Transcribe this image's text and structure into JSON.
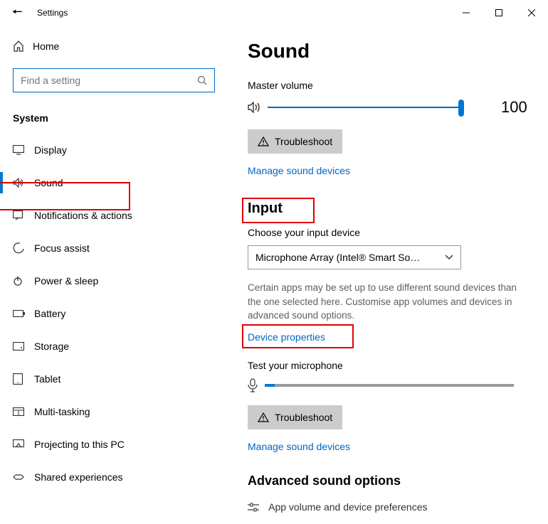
{
  "titlebar": {
    "title": "Settings"
  },
  "sidebar": {
    "home": "Home",
    "search_placeholder": "Find a setting",
    "section": "System",
    "items": [
      {
        "label": "Display"
      },
      {
        "label": "Sound",
        "selected": true
      },
      {
        "label": "Notifications & actions"
      },
      {
        "label": "Focus assist"
      },
      {
        "label": "Power & sleep"
      },
      {
        "label": "Battery"
      },
      {
        "label": "Storage"
      },
      {
        "label": "Tablet"
      },
      {
        "label": "Multi-tasking"
      },
      {
        "label": "Projecting to this PC"
      },
      {
        "label": "Shared experiences"
      }
    ]
  },
  "main": {
    "title": "Sound",
    "master_volume_label": "Master volume",
    "volume_value": "100",
    "troubleshoot": "Troubleshoot",
    "manage_devices": "Manage sound devices",
    "input_heading": "Input",
    "choose_input": "Choose your input device",
    "input_device": "Microphone Array (Intel® Smart So…",
    "input_help": "Certain apps may be set up to use different sound devices than the one selected here. Customise app volumes and devices in advanced sound options.",
    "device_properties": "Device properties",
    "test_mic": "Test your microphone",
    "troubleshoot2": "Troubleshoot",
    "manage_devices2": "Manage sound devices",
    "advanced_heading": "Advanced sound options",
    "cutoff_row": "App volume and device preferences"
  }
}
